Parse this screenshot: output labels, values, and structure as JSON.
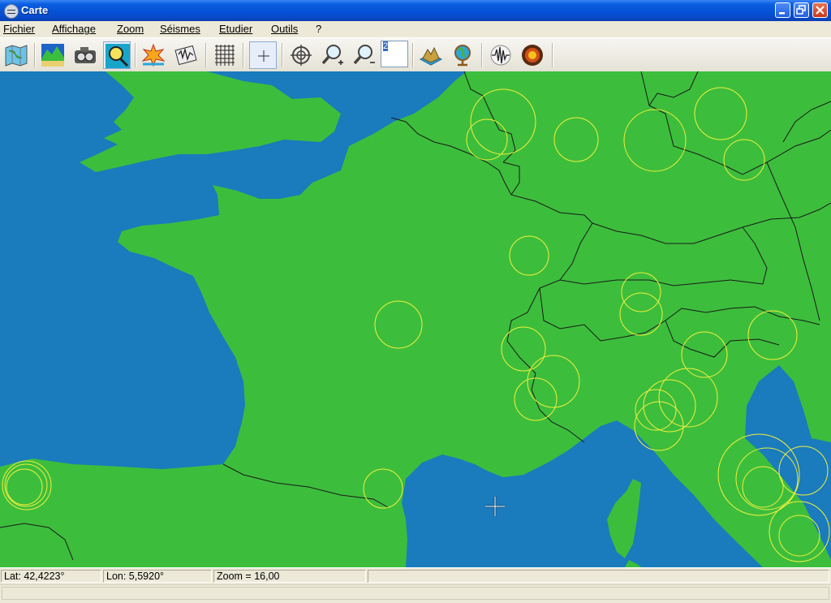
{
  "window": {
    "title": "Carte",
    "controls": [
      "minimize",
      "maximize",
      "close"
    ]
  },
  "menubar": {
    "items": [
      "Fichier",
      "Affichage",
      "Zoom",
      "Séismes",
      "Etudier",
      "Outils",
      "?"
    ]
  },
  "toolbar": {
    "buttons": [
      {
        "name": "map-icon"
      },
      {
        "name": "landscape-icon"
      },
      {
        "name": "camera-icon"
      },
      {
        "name": "magnifier-select-icon",
        "pressed": true
      },
      {
        "name": "earthquake-explosion-icon"
      },
      {
        "name": "seismograph-paper-icon"
      },
      {
        "name": "grid-icon"
      },
      {
        "name": "crosshair-icon",
        "pressed": true
      },
      {
        "name": "target-icon"
      },
      {
        "name": "zoom-in-icon"
      },
      {
        "name": "zoom-out-icon"
      },
      {
        "name": "relief-3d-icon"
      },
      {
        "name": "globe-icon"
      },
      {
        "name": "seismogram-icon"
      },
      {
        "name": "earth-core-icon"
      }
    ],
    "zoom_step_value": "2"
  },
  "map": {
    "colors": {
      "sea": "#1a7bbd",
      "land": "#3cbe3c",
      "border": "#1a1a1a",
      "quake_circle": "#f2ef3c"
    }
  },
  "statusbar": {
    "lat": "Lat: 42,4223°",
    "lon": "Lon: 5,5920°",
    "zoom": "Zoom = 16,00"
  }
}
